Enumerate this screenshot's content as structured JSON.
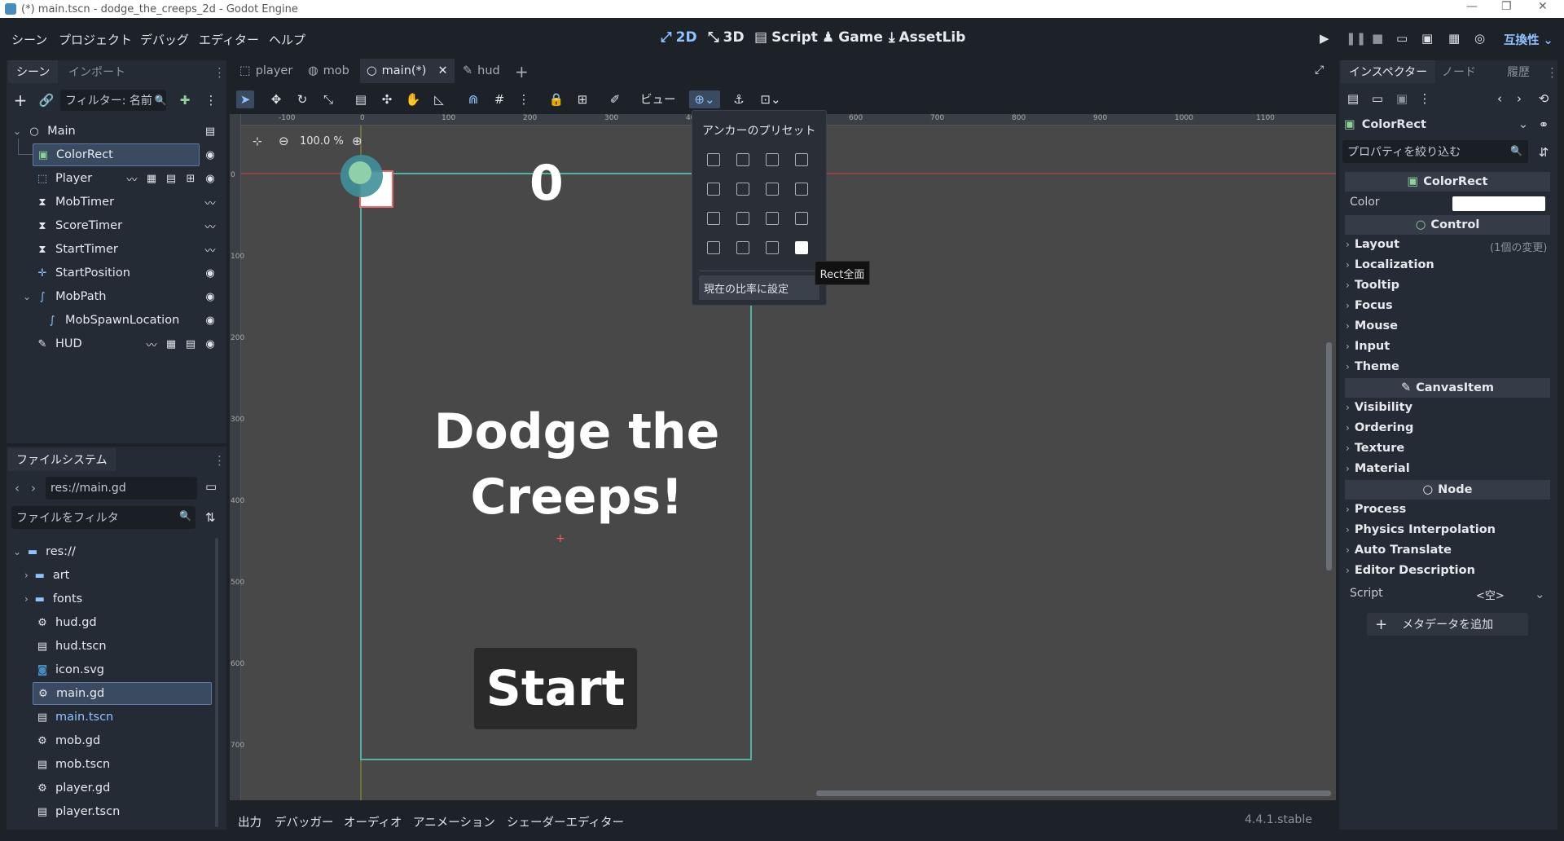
{
  "window": {
    "title": "(*) main.tscn - dodge_the_creeps_2d - Godot Engine"
  },
  "menus": [
    "シーン",
    "プロジェクト",
    "デバッグ",
    "エディター",
    "ヘルプ"
  ],
  "workspaces": [
    "2D",
    "3D",
    "Script",
    "Game",
    "AssetLib"
  ],
  "compat_label": "互換性",
  "scene_dock": {
    "tabs": [
      "シーン",
      "インポート"
    ],
    "filter_placeholder": "フィルター: 名前",
    "nodes": [
      {
        "name": "Main",
        "icon": "node2d-icon"
      },
      {
        "name": "ColorRect",
        "icon": "colorrect-icon"
      },
      {
        "name": "Player",
        "icon": "area2d-icon"
      },
      {
        "name": "MobTimer",
        "icon": "timer-icon"
      },
      {
        "name": "ScoreTimer",
        "icon": "timer-icon"
      },
      {
        "name": "StartTimer",
        "icon": "timer-icon"
      },
      {
        "name": "StartPosition",
        "icon": "marker2d-icon"
      },
      {
        "name": "MobPath",
        "icon": "path2d-icon"
      },
      {
        "name": "MobSpawnLocation",
        "icon": "pathfollow-icon"
      },
      {
        "name": "HUD",
        "icon": "canvaslayer-icon"
      }
    ]
  },
  "filesystem": {
    "title": "ファイルシステム",
    "path": "res://main.gd",
    "filter_placeholder": "ファイルをフィルタ",
    "items": [
      "res://",
      "art",
      "fonts",
      "hud.gd",
      "hud.tscn",
      "icon.svg",
      "main.gd",
      "main.tscn",
      "mob.gd",
      "mob.tscn",
      "player.gd",
      "player.tscn"
    ]
  },
  "scene_tabs": [
    "player",
    "mob",
    "main(*)",
    "hud"
  ],
  "toolbar": {
    "view_label": "ビュー",
    "zoom": "100.0 %"
  },
  "anchor_popup": {
    "title": "アンカーのプリセット",
    "ratio_button": "現在の比率に設定",
    "tooltip": "Rect全面"
  },
  "canvas": {
    "score": "0",
    "message_line1": "Dodge the",
    "message_line2": "Creeps!",
    "start_button": "Start"
  },
  "ruler_labels": [
    "-100",
    "0",
    "100",
    "200",
    "300",
    "400",
    "500",
    "600",
    "700",
    "800",
    "900",
    "1000",
    "1100"
  ],
  "ruler_v_labels": [
    "0",
    "100",
    "200",
    "300",
    "400",
    "500",
    "600",
    "700"
  ],
  "inspector": {
    "tabs": [
      "インスペクター",
      "ノード",
      "履歴"
    ],
    "node_name": "ColorRect",
    "filter_placeholder": "プロパティを絞り込む",
    "color_label": "Color",
    "color_value": "#ffffff",
    "sections": {
      "colorrect": "ColorRect",
      "control": "Control",
      "canvasitem": "CanvasItem",
      "node": "Node"
    },
    "control_items": [
      "Layout",
      "Localization",
      "Tooltip",
      "Focus",
      "Mouse",
      "Input",
      "Theme"
    ],
    "layout_note": "(1個の変更)",
    "canvas_items": [
      "Visibility",
      "Ordering",
      "Texture",
      "Material"
    ],
    "node_items": [
      "Process",
      "Physics Interpolation",
      "Auto Translate",
      "Editor Description"
    ],
    "script_label": "Script",
    "script_value": "<空>",
    "add_meta": "メタデータを追加"
  },
  "bottom_tabs": [
    "出力",
    "デバッガー",
    "オーディオ",
    "アニメーション",
    "シェーダーエディター"
  ],
  "version": "4.4.1.stable",
  "colors": {
    "accent": "#8ec3ff",
    "bg": "#1d2229",
    "panel": "#252b34",
    "path": "#4fb3a3",
    "viewport": "#484848"
  }
}
